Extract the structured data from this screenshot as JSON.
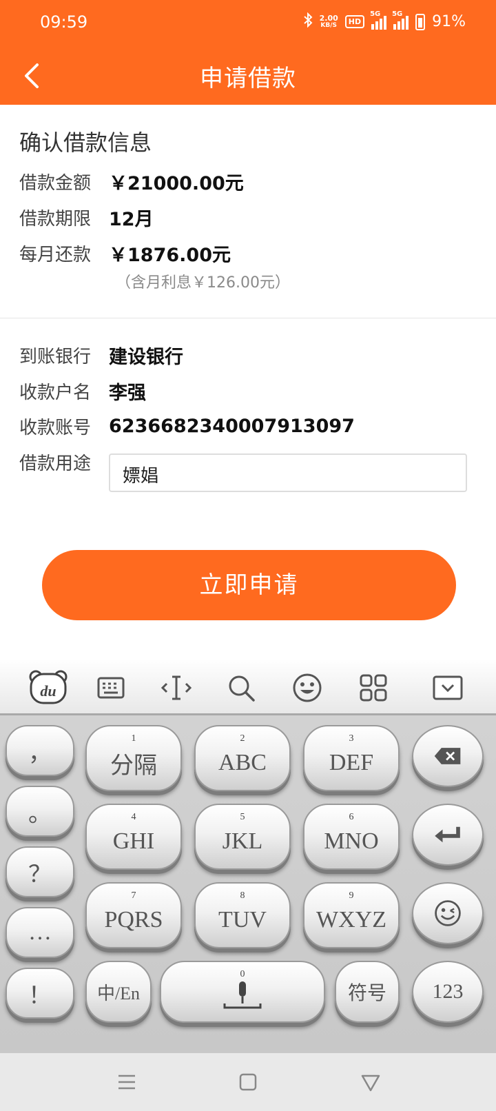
{
  "status_bar": {
    "time": "09:59",
    "net_speed_value": "2.00",
    "net_speed_unit": "KB/S",
    "hd_badge": "HD",
    "sim1": "5G",
    "sim2": "5G",
    "battery": "91%"
  },
  "header": {
    "title": "申请借款"
  },
  "confirm": {
    "section_title": "确认借款信息",
    "amount_label": "借款金额",
    "amount_value": "￥21000.00元",
    "term_label": "借款期限",
    "term_value": "12月",
    "monthly_label": "每月还款",
    "monthly_value": "￥1876.00元",
    "interest_note": "（含月利息￥126.00元）"
  },
  "account": {
    "bank_label": "到账银行",
    "bank_value": "建设银行",
    "name_label": "收款户名",
    "name_value": "李强",
    "number_label": "收款账号",
    "number_value": "6236682340007913097",
    "purpose_label": "借款用途",
    "purpose_value": "嫖娼"
  },
  "apply_button": "立即申请",
  "keyboard": {
    "toolbar_icons": [
      "baidu-du-icon",
      "keyboard-icon",
      "cursor-icon",
      "search-icon",
      "emoji-icon",
      "grid-icon",
      "collapse-icon"
    ],
    "logo_text": "du",
    "left_column": [
      "，",
      "。",
      "？",
      "…",
      "！"
    ],
    "grid": [
      {
        "num": "1",
        "label": "分隔"
      },
      {
        "num": "2",
        "label": "ABC"
      },
      {
        "num": "3",
        "label": "DEF"
      },
      {
        "num": "4",
        "label": "GHI"
      },
      {
        "num": "5",
        "label": "JKL"
      },
      {
        "num": "6",
        "label": "MNO"
      },
      {
        "num": "7",
        "label": "PQRS"
      },
      {
        "num": "8",
        "label": "TUV"
      },
      {
        "num": "9",
        "label": "WXYZ"
      }
    ],
    "lang_key": "中/En",
    "space_num": "0",
    "symbol_key": "符号",
    "numeric_key": "123"
  },
  "colors": {
    "accent": "#FF6A1F"
  }
}
